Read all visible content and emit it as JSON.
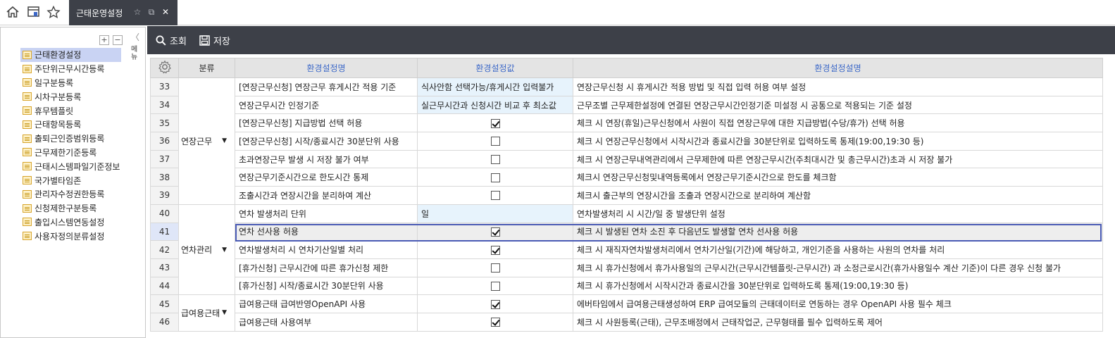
{
  "tabs": {
    "active_title": "근태운영설정"
  },
  "sidebar": {
    "collapse_label": "메뉴",
    "expand_symbol": "+",
    "collapse_symbol": "−",
    "items": [
      {
        "label": "근태환경설정"
      },
      {
        "label": "주단위근무시간등록"
      },
      {
        "label": "일구분등록"
      },
      {
        "label": "시차구분등록"
      },
      {
        "label": "휴무템플릿"
      },
      {
        "label": "근태항목등록"
      },
      {
        "label": "출퇴근인증범위등록"
      },
      {
        "label": "근무제한기준등록"
      },
      {
        "label": "근태시스템파일기준정보"
      },
      {
        "label": "국가별타임존"
      },
      {
        "label": "관리자수정권한등록"
      },
      {
        "label": "신청제한구분등록"
      },
      {
        "label": "출입시스템연동설정"
      },
      {
        "label": "사용자정의분류설정"
      }
    ]
  },
  "toolbar": {
    "search_label": "조회",
    "save_label": "저장"
  },
  "grid": {
    "headers": {
      "category": "분류",
      "name": "환경설정명",
      "value": "환경설정값",
      "description": "환경설정설명"
    },
    "groups": {
      "overtime": "연장근무",
      "leave": "연차관리",
      "payroll": "급여용근태"
    },
    "rows": [
      {
        "num": "33",
        "name": "[연장근무신청] 연장근무 휴게시간 적용 기준",
        "value": "식사안함 선택가능/휴게시간 입력불가",
        "desc": "연장근무신청 시 휴게시간 적용 방법 및 직접 입력 허용 여부 설정"
      },
      {
        "num": "34",
        "name": "연장근무시간 인정기준",
        "value": "실근무시간과 신청시간 비교 후 최소값",
        "desc": "근무조별 근무제한설정에 연결된 연장근무시간인정기준 미설정 시 공통으로 적용되는 기준 설정"
      },
      {
        "num": "35",
        "name": "[연장근무신청] 지급방법 선택 허용",
        "checked": true,
        "desc": "체크 시 연장(휴일)근무신청에서 사원이 직접 연장근무에 대한 지급방법(수당/휴가) 선택 허용"
      },
      {
        "num": "36",
        "name": "[연장근무신청] 시작/종료시간 30분단위 사용",
        "checked": false,
        "desc": "체크 시 연장근무신청에서 시작시간과 종료시간을 30분단위로 입력하도록 통제(19:00,19:30 등)"
      },
      {
        "num": "37",
        "name": "초과연장근무 발생 시 저장 불가 여부",
        "checked": false,
        "desc": "체크 시 연장근무내역관리에서 근무제한에 따른 연장근무시간(주최대시간 및 총근무시간)초과 시 저장 불가"
      },
      {
        "num": "38",
        "name": "연장근무기준시간으로 한도시간 통제",
        "checked": false,
        "desc": "체크시 연장근무신청및내역등록에서 연장근무기준시간으로 한도를 체크함"
      },
      {
        "num": "39",
        "name": "조출시간과 연장시간을 분리하여 계산",
        "checked": false,
        "desc": "체크시 출근부의 연장시간을 조출과 연장시간으로 분리하여 계산함"
      },
      {
        "num": "40",
        "name": "연차 발생처리 단위",
        "value": "일",
        "desc": "연차발생처리 시 시간/일 중 발생단위 설정"
      },
      {
        "num": "41",
        "name": "연차 선사용 허용",
        "checked": true,
        "desc": "체크 시 발생된 연차 소진 후 다음년도 발생할 연차 선사용 허용"
      },
      {
        "num": "42",
        "name": "연차발생처리 시 연차기산일별 처리",
        "checked": true,
        "desc": "체크 시 재직자연차발생처리에서 연차기산일(기간)에 해당하고, 개인기준을 사용하는 사원의 연차를 처리"
      },
      {
        "num": "43",
        "name": "[휴가신청] 근무시간에 따른 휴가신청 제한",
        "checked": false,
        "desc": "체크 시 휴가신청에서 휴가사용일의 근무시간(근무시간템플릿-근무시간) 과 소정근로시간(휴가사용일수 계산 기준)이 다른 경우 신청 불가"
      },
      {
        "num": "44",
        "name": "[휴가신청] 시작/종료시간 30분단위 사용",
        "checked": false,
        "desc": "체크 시 휴가신청에서 시작시간과 종료시간을 30분단위로 입력하도록 통제(19:00,19:30 등)"
      },
      {
        "num": "45",
        "name": "급여용근태 급여반영OpenAPI 사용",
        "checked": true,
        "desc": "에버타임에서 급여용근태생성하여 ERP 급여모듈의 근태데이터로 연동하는 경우 OpenAPI 사용 필수 체크"
      },
      {
        "num": "46",
        "name": "급여용근태 사용여부",
        "checked": true,
        "desc": "체크 시 사원등록(근태), 근무조배정에서 근태작업군, 근무형태를 필수 입력하도록 제어"
      }
    ]
  }
}
